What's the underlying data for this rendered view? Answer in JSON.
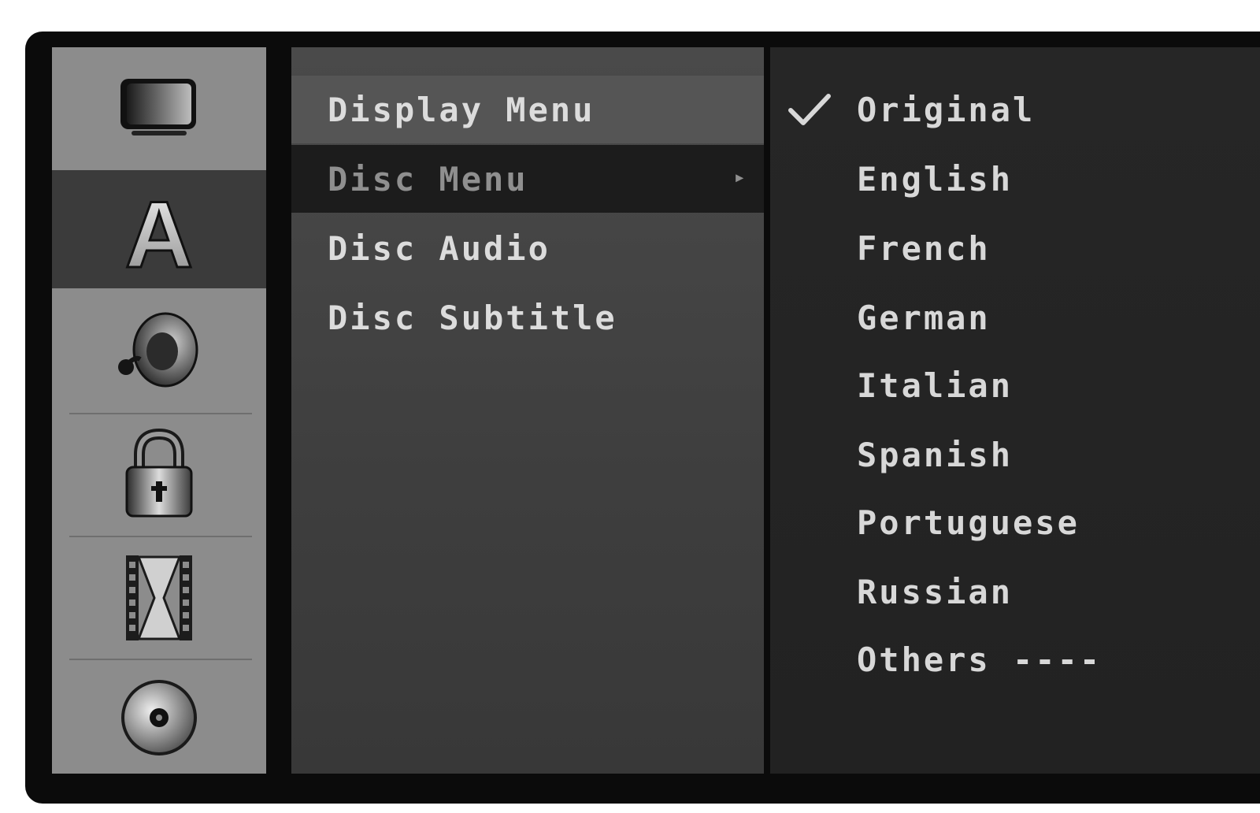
{
  "sidebar": {
    "icons": [
      {
        "name": "display-icon",
        "selected": false
      },
      {
        "name": "language-icon",
        "label": "A",
        "selected": true
      },
      {
        "name": "audio-icon",
        "selected": false
      },
      {
        "name": "lock-icon",
        "selected": false
      },
      {
        "name": "recording-icon",
        "selected": false
      },
      {
        "name": "disc-icon",
        "selected": false
      }
    ]
  },
  "menu": {
    "items": [
      {
        "label": "Display Menu"
      },
      {
        "label": "Disc Menu",
        "selected": true
      },
      {
        "label": "Disc Audio"
      },
      {
        "label": "Disc Subtitle"
      }
    ],
    "arrow": "▸"
  },
  "options": {
    "items": [
      {
        "label": "Original",
        "checked": true
      },
      {
        "label": "English"
      },
      {
        "label": "French"
      },
      {
        "label": "German"
      },
      {
        "label": "Italian"
      },
      {
        "label": "Spanish"
      },
      {
        "label": "Portuguese"
      },
      {
        "label": "Russian"
      },
      {
        "label": "Others ----"
      }
    ]
  },
  "colors": {
    "sidebar_bg": "#8c8c8c",
    "sidebar_selected": "#3b3b3b",
    "menu_bg": "#454545",
    "menu_selected": "#1c1c1c",
    "options_bg": "#242424",
    "text": "#dcdcdc"
  }
}
